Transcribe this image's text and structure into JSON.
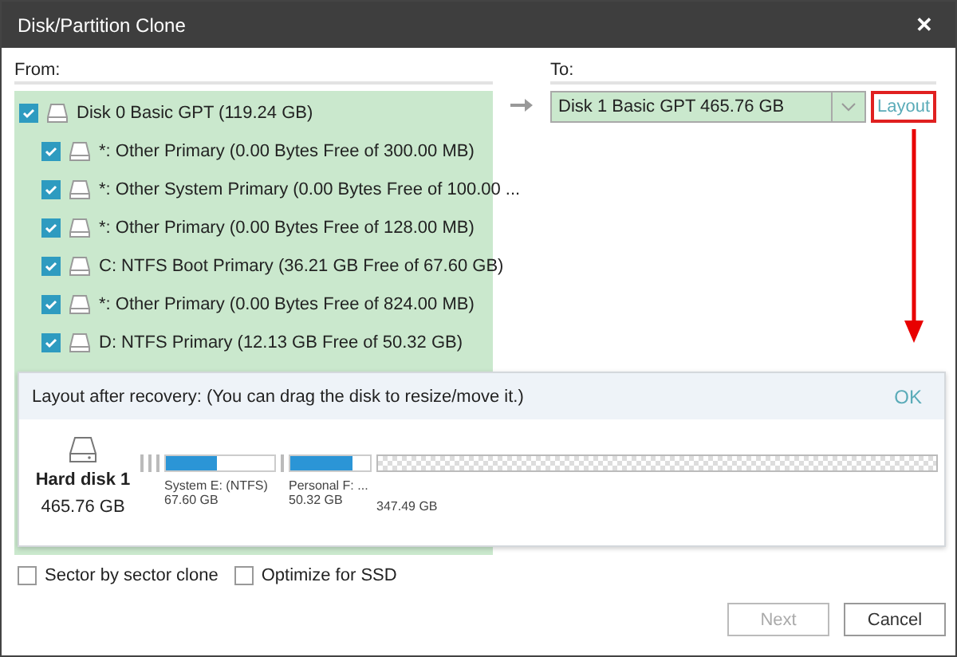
{
  "window": {
    "title": "Disk/Partition Clone",
    "close": "✕"
  },
  "from": {
    "label": "From:",
    "tree": [
      {
        "label": "Disk 0 Basic GPT (119.24 GB)",
        "checked": true,
        "children": [
          {
            "label": "*: Other Primary  (0.00 Bytes Free of 300.00 MB)",
            "checked": true
          },
          {
            "label": "*: Other System Primary  (0.00 Bytes Free of 100.00 ...",
            "checked": true
          },
          {
            "label": "*: Other Primary  (0.00 Bytes Free of 128.00 MB)",
            "checked": true
          },
          {
            "label": "C: NTFS Boot Primary  (36.21 GB Free of 67.60 GB)",
            "checked": true
          },
          {
            "label": "*: Other Primary  (0.00 Bytes Free of 824.00 MB)",
            "checked": true
          },
          {
            "label": "D: NTFS Primary  (12.13 GB Free of 50.32 GB)",
            "checked": true
          }
        ]
      }
    ]
  },
  "to": {
    "label": "To:",
    "target": "Disk 1 Basic GPT 465.76 GB",
    "layout_link": "Layout",
    "highlighted": true
  },
  "layout_panel": {
    "title": "Layout after recovery: (You can drag the disk to resize/move it.)",
    "ok": "OK",
    "disk_name": "Hard disk 1",
    "disk_size": "465.76 GB",
    "partitions": [
      {
        "kind": "sliver"
      },
      {
        "kind": "sliver"
      },
      {
        "kind": "sliver"
      },
      {
        "kind": "volume",
        "name": "System E: (NTFS)",
        "size": "67.60 GB",
        "level": 0.47
      },
      {
        "kind": "sliver"
      },
      {
        "kind": "volume",
        "name": "Personal F: ...",
        "size": "50.32 GB",
        "level": 0.77
      },
      {
        "kind": "unallocated",
        "size": "347.49 GB"
      }
    ]
  },
  "options": [
    {
      "label": "Sector by sector clone",
      "checked": false
    },
    {
      "label": "Optimize for SSD",
      "checked": false
    }
  ],
  "buttons": [
    {
      "label": "Next",
      "disabled": true
    },
    {
      "label": "Cancel",
      "disabled": false
    }
  ]
}
